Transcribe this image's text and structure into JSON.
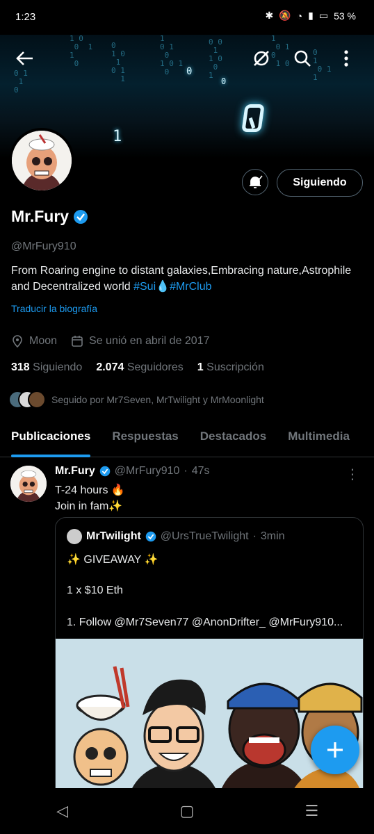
{
  "status": {
    "time": "1:23",
    "battery": "53 %"
  },
  "profile": {
    "name": "Mr.Fury",
    "handle": "@MrFury910",
    "bio_text": "From Roaring engine to distant galaxies,Embracing nature,Astrophile and Decentralized world",
    "bio_tag1": "#Sui",
    "bio_drop": "💧",
    "bio_tag2": "#MrClub",
    "translate": "Traducir la biografía",
    "location": "Moon",
    "joined": "Se unió en abril de 2017",
    "following_count": "318",
    "following_label": "Siguiendo",
    "followers_count": "2.074",
    "followers_label": "Seguidores",
    "subs_count": "1",
    "subs_label": "Suscripción",
    "followed_by": "Seguido por Mr7Seven, MrTwilight y MrMoonlight",
    "follow_button": "Siguiendo"
  },
  "tabs": [
    "Publicaciones",
    "Respuestas",
    "Destacados",
    "Multimedia"
  ],
  "post": {
    "name": "Mr.Fury",
    "handle": "@MrFury910",
    "dot": "·",
    "time": "47s",
    "line1": "T-24 hours 🔥",
    "line2": "Join in fam✨",
    "quote": {
      "name": "MrTwilight",
      "handle": "@UrsTrueTwilight",
      "dot": "·",
      "time": "3min",
      "line1": "✨ GIVEAWAY ✨",
      "line2": "1 x $10 Eth",
      "line3": "1. Follow @Mr7Seven77 @AnonDrifter_ @MrFury910..."
    }
  },
  "colors": {
    "accent": "#1d9bf0",
    "muted": "#71767b",
    "border": "#2f3336"
  }
}
